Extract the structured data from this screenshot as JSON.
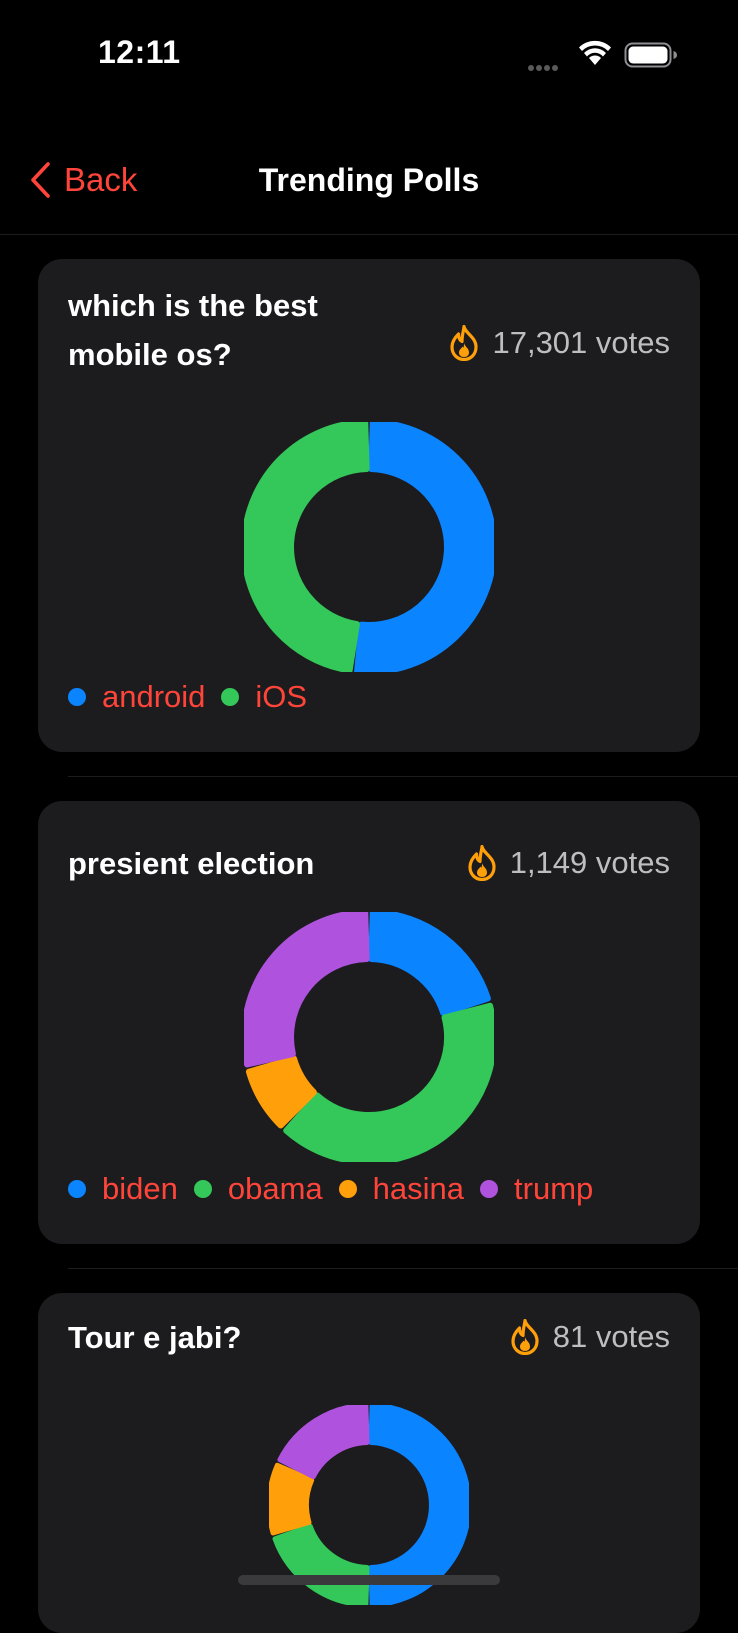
{
  "status_bar": {
    "time": "12:11",
    "icons": [
      "cellular-dots-icon",
      "wifi-icon",
      "battery-icon"
    ]
  },
  "nav": {
    "back_label": "Back",
    "title": "Trending Polls",
    "accent": "#ff453a"
  },
  "polls": [
    {
      "title": "which is the best mobile os?",
      "votes": "17,301 votes",
      "chart_data": {
        "type": "pie",
        "variant": "donut",
        "series": [
          {
            "name": "android",
            "color": "#0a84ff",
            "value": 0.52
          },
          {
            "name": "iOS",
            "color": "#34c759",
            "value": 0.48
          }
        ]
      }
    },
    {
      "title": "presient election",
      "votes": "1,149 votes",
      "chart_data": {
        "type": "pie",
        "variant": "donut",
        "series": [
          {
            "name": "biden",
            "color": "#0a84ff",
            "value": 0.205
          },
          {
            "name": "obama",
            "color": "#34c759",
            "value": 0.415
          },
          {
            "name": "hasina",
            "color": "#ff9f0a",
            "value": 0.09
          },
          {
            "name": "trump",
            "color": "#af52de",
            "value": 0.29
          }
        ]
      }
    },
    {
      "title": "Tour e jabi?",
      "votes": "81 votes",
      "chart_data": {
        "type": "pie",
        "variant": "donut",
        "series": [
          {
            "name": "",
            "color": "#0a84ff",
            "value": 0.5
          },
          {
            "name": "",
            "color": "#34c759",
            "value": 0.2
          },
          {
            "name": "",
            "color": "#ff9f0a",
            "value": 0.12
          },
          {
            "name": "",
            "color": "#af52de",
            "value": 0.18
          }
        ]
      }
    }
  ]
}
